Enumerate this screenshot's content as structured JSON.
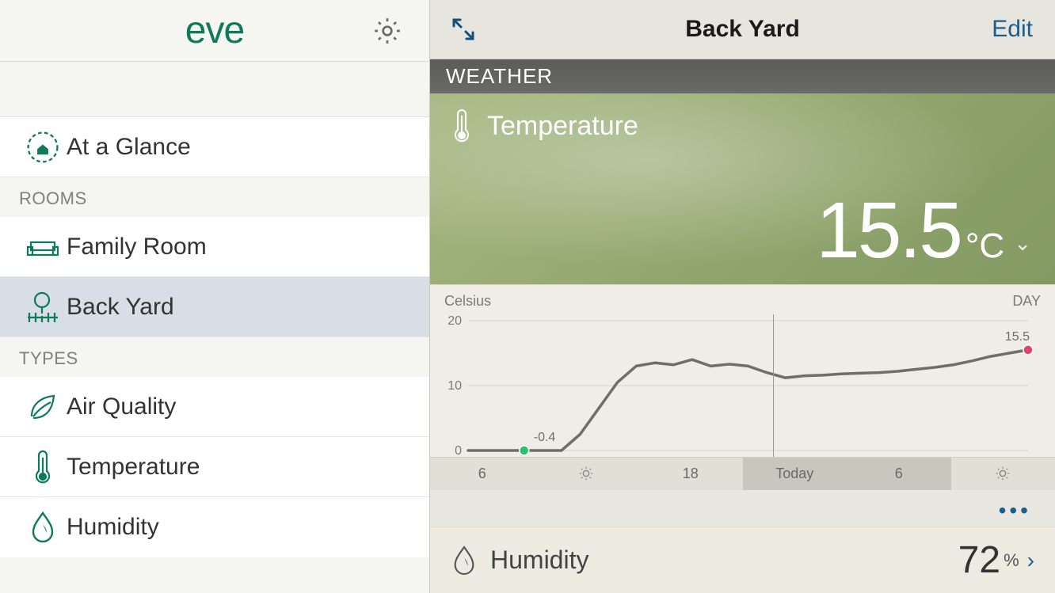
{
  "brand": "eve",
  "sidebar": {
    "at_a_glance": "At a Glance",
    "rooms_label": "ROOMS",
    "types_label": "TYPES",
    "rooms": [
      {
        "label": "Family Room"
      },
      {
        "label": "Back Yard"
      }
    ],
    "types": [
      {
        "label": "Air Quality"
      },
      {
        "label": "Temperature"
      },
      {
        "label": "Humidity"
      }
    ]
  },
  "main": {
    "title": "Back Yard",
    "edit": "Edit",
    "section": "WEATHER",
    "temperature": {
      "title": "Temperature",
      "value": "15.5",
      "unit": "°C"
    },
    "humidity": {
      "title": "Humidity",
      "value": "72",
      "unit": "%"
    }
  },
  "chart_data": {
    "type": "line",
    "title": "Temperature",
    "ylabel": "Celsius",
    "period_label": "DAY",
    "xlim": [
      0,
      30
    ],
    "ylim": [
      0,
      20
    ],
    "yticks": [
      0,
      10,
      20
    ],
    "x": [
      0,
      1,
      2,
      3,
      4,
      5,
      6,
      7,
      8,
      9,
      10,
      11,
      12,
      13,
      14,
      15,
      16,
      17,
      18,
      19,
      20,
      21,
      22,
      23,
      24,
      25,
      26,
      27,
      28,
      29,
      30
    ],
    "values": [
      -0.1,
      -0.2,
      -0.3,
      -0.4,
      -0.3,
      0.0,
      2.5,
      6.5,
      10.5,
      13.0,
      13.5,
      13.2,
      14.0,
      13.0,
      13.3,
      13.0,
      12.0,
      11.2,
      11.5,
      11.6,
      11.8,
      11.9,
      12.0,
      12.2,
      12.5,
      12.8,
      13.2,
      13.8,
      14.5,
      15.0,
      15.5
    ],
    "annotations": [
      {
        "x": 3,
        "y": -0.4,
        "label": "-0.4",
        "marker": "start"
      },
      {
        "x": 30,
        "y": 15.5,
        "label": "15.5",
        "marker": "end"
      }
    ],
    "timeline": [
      {
        "label": "6",
        "shaded": false
      },
      {
        "label": "sun",
        "shaded": false
      },
      {
        "label": "18",
        "shaded": false
      },
      {
        "label": "Today",
        "shaded": true
      },
      {
        "label": "6",
        "shaded": true
      },
      {
        "label": "sun",
        "shaded": false
      }
    ]
  }
}
